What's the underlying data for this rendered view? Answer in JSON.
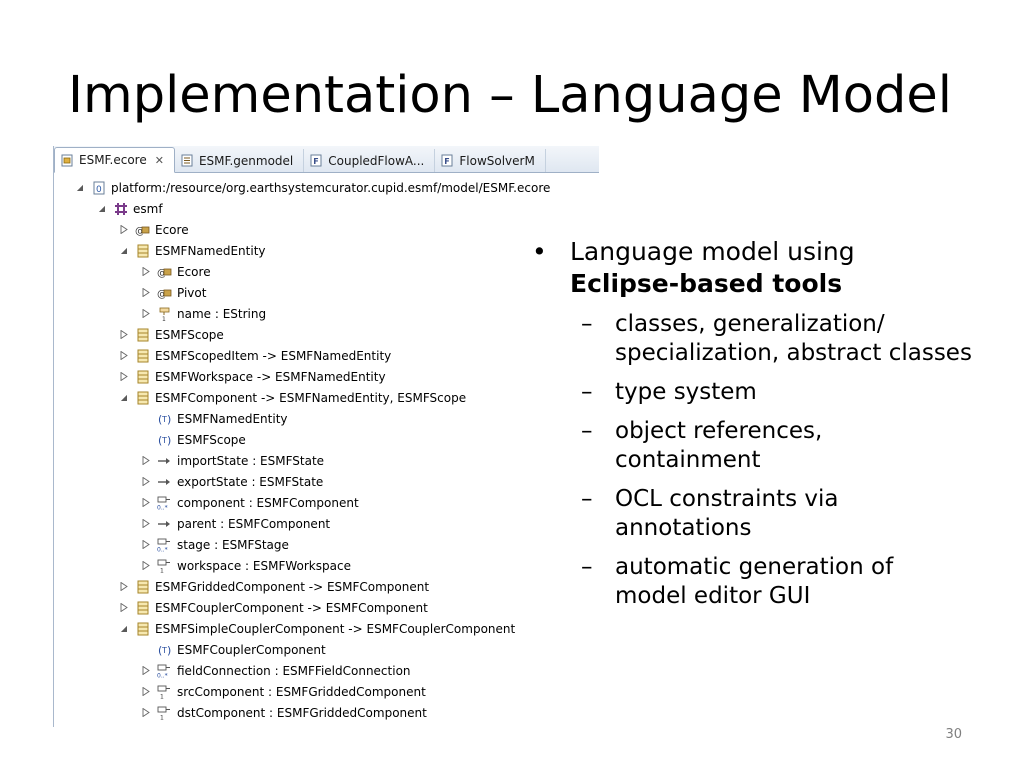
{
  "slide": {
    "title": "Implementation – Language Model",
    "page_number": "30"
  },
  "editor": {
    "tabs": [
      {
        "label": "ESMF.ecore",
        "icon": "ecore-file-icon",
        "active": true,
        "close": "✕"
      },
      {
        "label": "ESMF.genmodel",
        "icon": "genmodel-file-icon",
        "active": false
      },
      {
        "label": "CoupledFlowA...",
        "icon": "fortran-file-icon",
        "active": false
      },
      {
        "label": "FlowSolverM",
        "icon": "fortran-file-icon",
        "active": false
      }
    ],
    "tree": [
      {
        "indent": 0,
        "toggle": "open",
        "icon": "resource-icon",
        "label": "platform:/resource/org.earthsystemcurator.cupid.esmf/model/ESMF.ecore"
      },
      {
        "indent": 1,
        "toggle": "open",
        "icon": "package-icon",
        "label": "esmf"
      },
      {
        "indent": 2,
        "toggle": "closed",
        "icon": "annotation-icon",
        "label": "Ecore"
      },
      {
        "indent": 2,
        "toggle": "open",
        "icon": "class-icon",
        "label": "ESMFNamedEntity"
      },
      {
        "indent": 3,
        "toggle": "closed",
        "icon": "annotation-icon",
        "label": "Ecore"
      },
      {
        "indent": 3,
        "toggle": "closed",
        "icon": "annotation-icon",
        "label": "Pivot"
      },
      {
        "indent": 3,
        "toggle": "closed",
        "icon": "attribute-icon",
        "label": "name : EString"
      },
      {
        "indent": 2,
        "toggle": "closed",
        "icon": "class-icon",
        "label": "ESMFScope"
      },
      {
        "indent": 2,
        "toggle": "closed",
        "icon": "class-icon",
        "label": "ESMFScopedItem -> ESMFNamedEntity"
      },
      {
        "indent": 2,
        "toggle": "closed",
        "icon": "class-icon",
        "label": "ESMFWorkspace -> ESMFNamedEntity"
      },
      {
        "indent": 2,
        "toggle": "open",
        "icon": "class-icon",
        "label": "ESMFComponent -> ESMFNamedEntity, ESMFScope"
      },
      {
        "indent": 3,
        "toggle": "none",
        "icon": "generic-type-icon",
        "label": "ESMFNamedEntity"
      },
      {
        "indent": 3,
        "toggle": "none",
        "icon": "generic-type-icon",
        "label": "ESMFScope"
      },
      {
        "indent": 3,
        "toggle": "closed",
        "icon": "reference-icon",
        "label": "importState : ESMFState"
      },
      {
        "indent": 3,
        "toggle": "closed",
        "icon": "reference-icon",
        "label": "exportState : ESMFState"
      },
      {
        "indent": 3,
        "toggle": "closed",
        "icon": "containment-many-icon",
        "label": "component : ESMFComponent"
      },
      {
        "indent": 3,
        "toggle": "closed",
        "icon": "reference-icon",
        "label": "parent : ESMFComponent"
      },
      {
        "indent": 3,
        "toggle": "closed",
        "icon": "containment-many-icon",
        "label": "stage : ESMFStage"
      },
      {
        "indent": 3,
        "toggle": "closed",
        "icon": "containment-one-icon",
        "label": "workspace : ESMFWorkspace"
      },
      {
        "indent": 2,
        "toggle": "closed",
        "icon": "class-icon",
        "label": "ESMFGriddedComponent -> ESMFComponent"
      },
      {
        "indent": 2,
        "toggle": "closed",
        "icon": "class-icon",
        "label": "ESMFCouplerComponent -> ESMFComponent"
      },
      {
        "indent": 2,
        "toggle": "open",
        "icon": "class-icon",
        "label": "ESMFSimpleCouplerComponent -> ESMFCouplerComponent"
      },
      {
        "indent": 3,
        "toggle": "none",
        "icon": "generic-type-icon",
        "label": "ESMFCouplerComponent"
      },
      {
        "indent": 3,
        "toggle": "closed",
        "icon": "containment-many-icon",
        "label": "fieldConnection : ESMFFieldConnection"
      },
      {
        "indent": 3,
        "toggle": "closed",
        "icon": "containment-one-icon",
        "label": "srcComponent : ESMFGriddedComponent"
      },
      {
        "indent": 3,
        "toggle": "closed",
        "icon": "containment-one-icon",
        "label": "dstComponent : ESMFGriddedComponent"
      }
    ]
  },
  "bullets": {
    "main_prefix": "Language model using",
    "main_bold": "Eclipse-based tools",
    "bullet_symbol": "•",
    "dash_symbol": "–",
    "sub": [
      "classes, generalization/ specialization, abstract classes",
      "type system",
      "object references, containment",
      "OCL constraints via annotations",
      "automatic generation of model editor GUI"
    ]
  }
}
